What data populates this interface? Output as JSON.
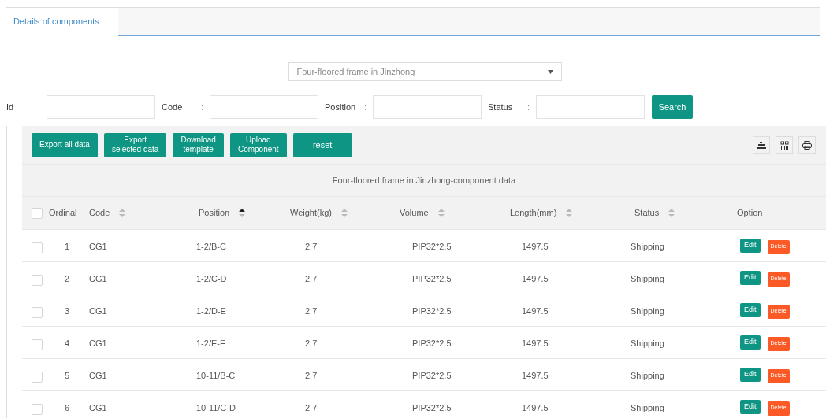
{
  "tabs": [
    {
      "label": "Details of components",
      "selected": true
    }
  ],
  "project_select": {
    "value": "Four-floored frame in Jinzhong"
  },
  "filters": [
    {
      "label": "Id",
      "separator": ":"
    },
    {
      "label": "Code",
      "separator": ":"
    },
    {
      "label": "Position",
      "separator": ":"
    },
    {
      "label": "Status",
      "separator": ":"
    }
  ],
  "search_button": "Search",
  "toolbar_buttons": [
    {
      "lines": [
        "Export all data"
      ]
    },
    {
      "lines": [
        "Export",
        "selected data"
      ]
    },
    {
      "lines": [
        "Download",
        "template"
      ]
    },
    {
      "lines": [
        "Upload",
        "Component"
      ]
    },
    {
      "lines": [
        "reset"
      ]
    }
  ],
  "table": {
    "title": "Four-floored frame in Jinzhong-component data",
    "select_all_checked": false,
    "columns": [
      {
        "label": "Ordinal",
        "sortable": false
      },
      {
        "label": "Code",
        "sortable": true,
        "sorted_ascending": false
      },
      {
        "label": "Position",
        "sortable": true,
        "sorted_ascending": true
      },
      {
        "label": "Weight(kg)",
        "sortable": true,
        "sorted_ascending": false
      },
      {
        "label": "Volume",
        "sortable": true,
        "sorted_ascending": false
      },
      {
        "label": "Length(mm)",
        "sortable": true,
        "sorted_ascending": false
      },
      {
        "label": "Status",
        "sortable": true,
        "sorted_ascending": false
      },
      {
        "label": "Option",
        "sortable": false
      }
    ],
    "rows": [
      {
        "selected": false,
        "cells": [
          "1",
          "CG1",
          "1-2/B-C",
          "2.7",
          "PIP32*2.5",
          "1497.5",
          "Shipping"
        ],
        "actions": [
          "Edit",
          "Delete"
        ]
      },
      {
        "selected": false,
        "cells": [
          "2",
          "CG1",
          "1-2/C-D",
          "2.7",
          "PIP32*2.5",
          "1497.5",
          "Shipping"
        ],
        "actions": [
          "Edit",
          "Delete"
        ]
      },
      {
        "selected": false,
        "cells": [
          "3",
          "CG1",
          "1-2/D-E",
          "2.7",
          "PIP32*2.5",
          "1497.5",
          "Shipping"
        ],
        "actions": [
          "Edit",
          "Delete"
        ]
      },
      {
        "selected": false,
        "cells": [
          "4",
          "CG1",
          "1-2/E-F",
          "2.7",
          "PIP32*2.5",
          "1497.5",
          "Shipping"
        ],
        "actions": [
          "Edit",
          "Delete"
        ]
      },
      {
        "selected": false,
        "cells": [
          "5",
          "CG1",
          "10-11/B-C",
          "2.7",
          "PIP32*2.5",
          "1497.5",
          "Shipping"
        ],
        "actions": [
          "Edit",
          "Delete"
        ]
      },
      {
        "selected": false,
        "cells": [
          "6",
          "CG1",
          "10-11/C-D",
          "2.7",
          "PIP32*2.5",
          "1497.5",
          "Shipping"
        ],
        "actions": [
          "Edit",
          "Delete"
        ]
      }
    ]
  }
}
